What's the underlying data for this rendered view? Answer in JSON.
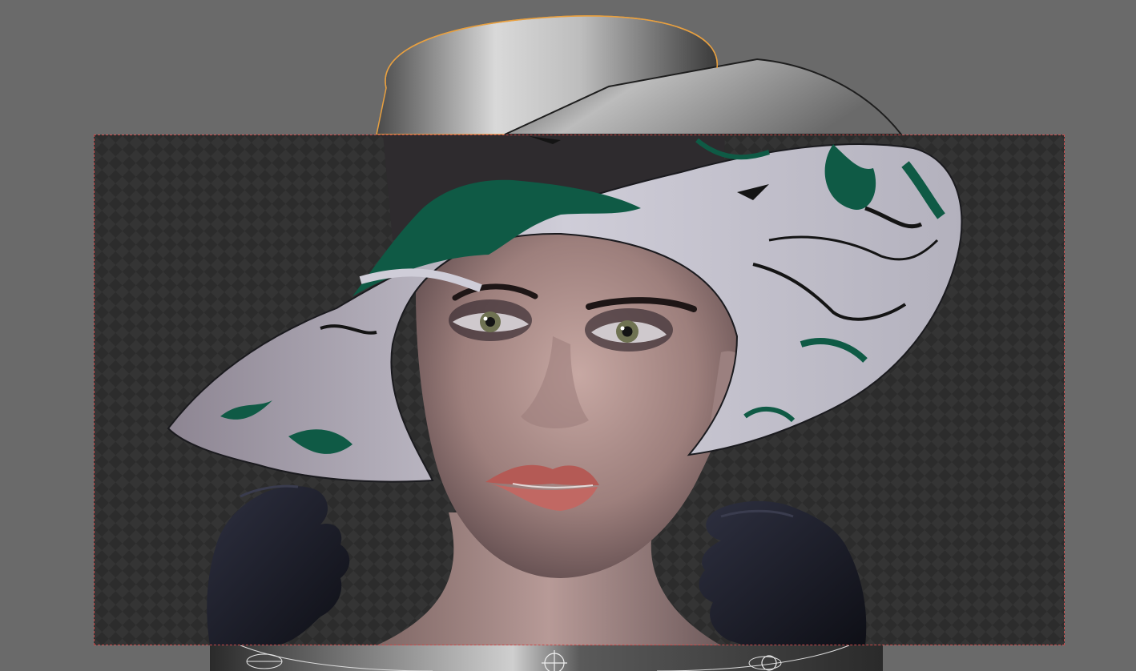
{
  "app": {
    "view": "3d-viewport",
    "mode": "rendered-preview"
  },
  "colors": {
    "viewport_background": "#6a6a6a",
    "transparent_checker_dark": "#2c2c2c",
    "transparent_checker_light": "#353535",
    "render_border": "#c94a4a",
    "selection_outline": "#e8a040",
    "hat_brim_fabric": "#c9c7d2",
    "hat_pattern_green": "#0f5a45",
    "skin": "#a88a86",
    "glove": "#1a1c28",
    "lips": "#b45a55"
  },
  "icons": {
    "armature_bone": "armature-bone-icon",
    "empty_object": "empty-target-icon"
  }
}
